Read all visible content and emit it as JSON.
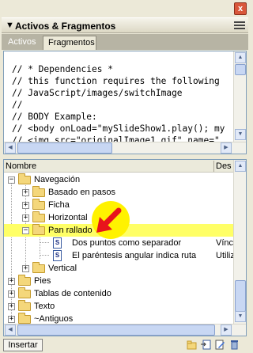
{
  "panel": {
    "title": "Activos & Fragmentos",
    "close_glyph": "x"
  },
  "tabs": [
    {
      "label": "Activos",
      "active": false
    },
    {
      "label": "Fragmentos",
      "active": true
    }
  ],
  "code_preview": {
    "lines": [
      "// * Dependencies *",
      "// this function requires the following",
      "// JavaScript/images/switchImage",
      "//",
      "// BODY Example:",
      "// <body onLoad=\"mySlideShow1.play(); my",
      "// <img src=\"originalImage1.gif\" name=\""
    ]
  },
  "tree": {
    "columns": {
      "name": "Nombre",
      "description": "Des"
    },
    "items": [
      {
        "label": "Navegación",
        "type": "folder",
        "level": 0,
        "expanded": true
      },
      {
        "label": "Basado en pasos",
        "type": "folder",
        "level": 1,
        "expanded": false
      },
      {
        "label": "Ficha",
        "type": "folder",
        "level": 1,
        "expanded": false
      },
      {
        "label": "Horizontal",
        "type": "folder",
        "level": 1,
        "expanded": false
      },
      {
        "label": "Pan rallado",
        "type": "folder",
        "level": 1,
        "expanded": true,
        "highlighted": true
      },
      {
        "label": "Dos puntos como separador",
        "type": "snippet",
        "level": 2,
        "description": "Vínc"
      },
      {
        "label": "El paréntesis angular indica ruta",
        "type": "snippet",
        "level": 2,
        "description": "Utiliz"
      },
      {
        "label": "Vertical",
        "type": "folder",
        "level": 1,
        "expanded": false
      },
      {
        "label": "Pies",
        "type": "folder",
        "level": 0,
        "expanded": false
      },
      {
        "label": "Tablas de contenido",
        "type": "folder",
        "level": 0,
        "expanded": false
      },
      {
        "label": "Texto",
        "type": "folder",
        "level": 0,
        "expanded": false
      },
      {
        "label": "~Antiguos",
        "type": "folder",
        "level": 0,
        "expanded": false
      }
    ]
  },
  "footer": {
    "insert_label": "Insertar"
  },
  "colors": {
    "highlight": "#ffff66",
    "annotation_arrow": "#e8141c",
    "annotation_circle": "#fff200"
  }
}
